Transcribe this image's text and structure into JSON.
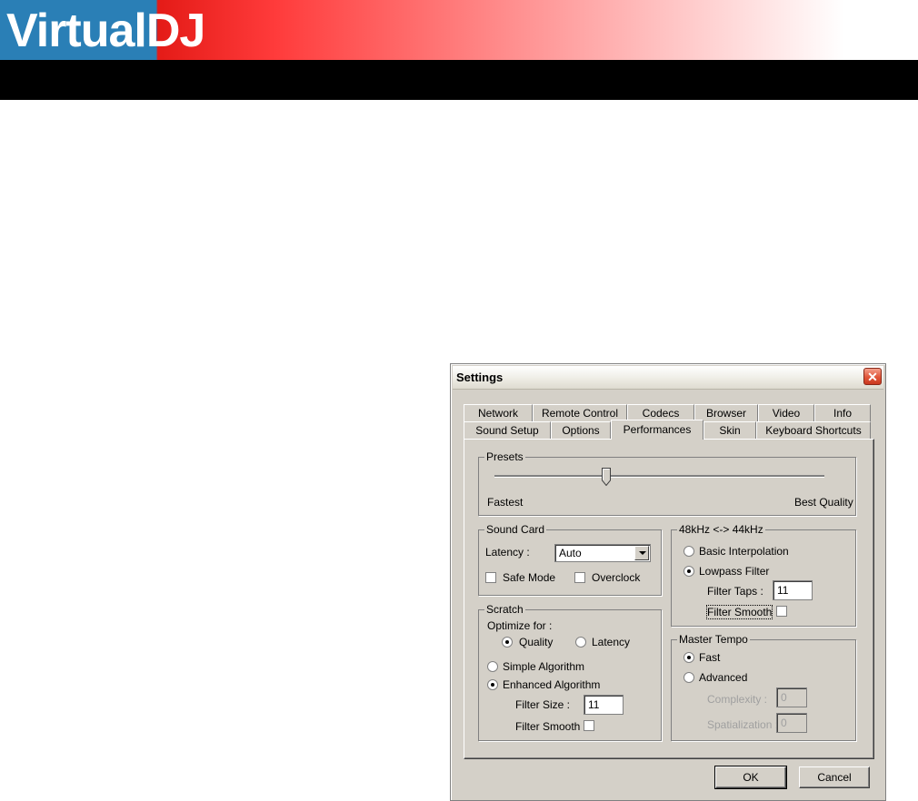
{
  "header": {
    "logo_part1": "Virtual",
    "logo_part2": "DJ"
  },
  "dialog": {
    "title": "Settings",
    "close_label": "✕",
    "tabs_row1": [
      "Network",
      "Remote Control",
      "Codecs",
      "Browser",
      "Video",
      "Info"
    ],
    "tabs_row2": [
      "Sound Setup",
      "Options",
      "Performances",
      "Skin",
      "Keyboard Shortcuts"
    ],
    "active_tab": "Performances",
    "presets": {
      "legend": "Presets",
      "left_label": "Fastest",
      "right_label": "Best Quality",
      "slider_fraction": 0.34
    },
    "sound_card": {
      "legend": "Sound Card",
      "latency_label": "Latency :",
      "latency_value": "Auto",
      "safe_mode": "Safe Mode",
      "safe_mode_checked": false,
      "overclock": "Overclock",
      "overclock_checked": false
    },
    "scratch": {
      "legend": "Scratch",
      "optimize_label": "Optimize for :",
      "quality": "Quality",
      "latency": "Latency",
      "optimize_selected": "Quality",
      "simple": "Simple Algorithm",
      "enhanced": "Enhanced Algorithm",
      "algorithm_selected": "Enhanced Algorithm",
      "filter_size_label": "Filter Size :",
      "filter_size_value": "11",
      "filter_smooth_label": "Filter Smooth",
      "filter_smooth_checked": false
    },
    "resample": {
      "legend": "48kHz <-> 44kHz",
      "basic": "Basic Interpolation",
      "lowpass": "Lowpass Filter",
      "selected": "Lowpass Filter",
      "filter_taps_label": "Filter Taps :",
      "filter_taps_value": "11",
      "filter_smooth_label": "Filter Smooth",
      "filter_smooth_checked": false
    },
    "master_tempo": {
      "legend": "Master Tempo",
      "fast": "Fast",
      "advanced": "Advanced",
      "selected": "Fast",
      "complexity_label": "Complexity :",
      "complexity_value": "0",
      "spatialization_label": "Spatialization :",
      "spatialization_value": "0"
    },
    "ok_label": "OK",
    "cancel_label": "Cancel"
  }
}
